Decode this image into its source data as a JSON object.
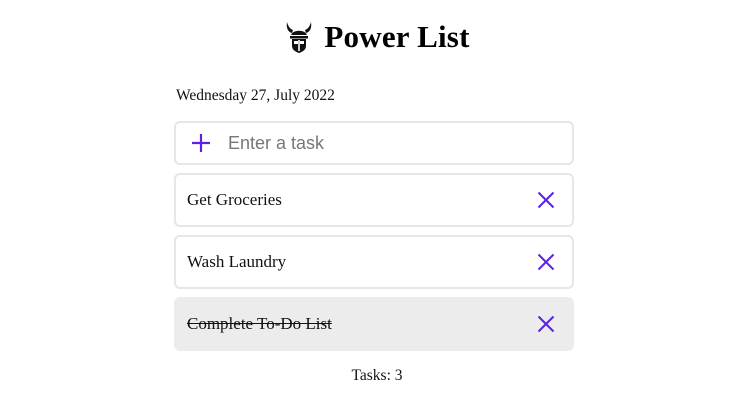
{
  "app": {
    "title": "Power List",
    "logo_icon": "viking-helmet-icon",
    "accent_color": "#5b22e6"
  },
  "date_text": "Wednesday 27, July 2022",
  "new_task": {
    "placeholder": "Enter a task",
    "value": "",
    "add_icon": "plus-icon"
  },
  "tasks": [
    {
      "label": "Get Groceries",
      "completed": false,
      "delete_icon": "close-icon"
    },
    {
      "label": "Wash Laundry",
      "completed": false,
      "delete_icon": "close-icon"
    },
    {
      "label": "Complete To-Do List",
      "completed": true,
      "delete_icon": "close-icon"
    }
  ],
  "footer": {
    "count_label": "Tasks:",
    "count_value": "3"
  }
}
